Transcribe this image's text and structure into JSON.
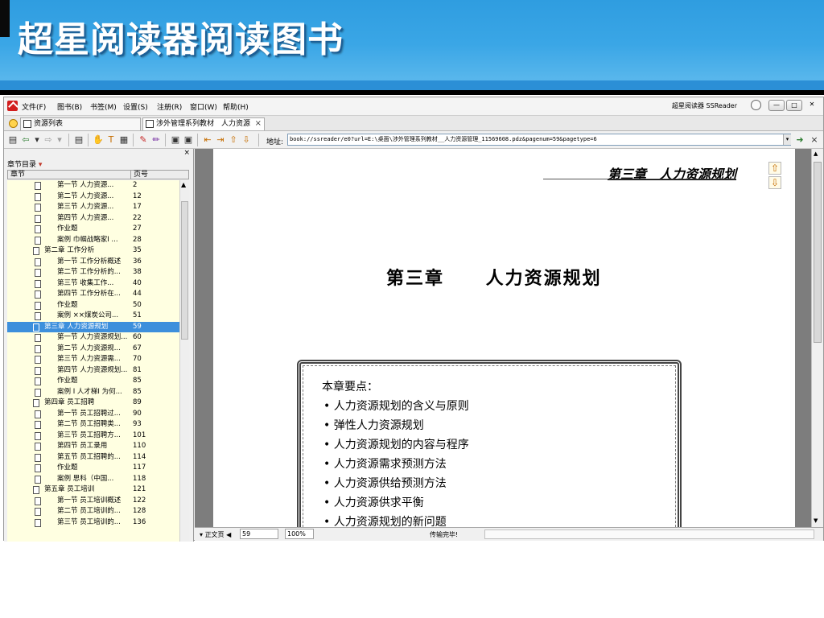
{
  "slide": {
    "title": "超星阅读器阅读图书"
  },
  "menubar": {
    "items": [
      "文件(F)",
      "图书(B)",
      "书签(M)",
      "设置(S)",
      "注册(R)",
      "窗口(W)",
      "帮助(H)"
    ],
    "brand": "超星阅读器 SSReader"
  },
  "tabs": [
    {
      "label": "资源列表"
    },
    {
      "label": "涉外管理系列教材　人力资源"
    }
  ],
  "address": {
    "label": "地址:",
    "value": "book://ssreader/e0?url=E:\\桌面\\涉外管理系列教材__人力资源管理_11569608.pdz&pagenum=59&pagetype=6"
  },
  "sidebar": {
    "close": "×",
    "title": "章节目录",
    "col_chapter": "章节",
    "col_page": "页号",
    "selected_index": 13,
    "items": [
      {
        "title": "第一节 人力资源...",
        "page": "2",
        "level": 2
      },
      {
        "title": "第二节 人力资源...",
        "page": "12",
        "level": 2
      },
      {
        "title": "第三节 人力资源...",
        "page": "17",
        "level": 2
      },
      {
        "title": "第四节 人力资源...",
        "page": "22",
        "level": 2
      },
      {
        "title": "作业题",
        "page": "27",
        "level": 2
      },
      {
        "title": "案例 巾帼战略家I ...",
        "page": "28",
        "level": 2
      },
      {
        "title": "第二章 工作分析",
        "page": "35",
        "level": 1
      },
      {
        "title": "第一节 工作分析概述",
        "page": "36",
        "level": 2
      },
      {
        "title": "第二节 工作分析的...",
        "page": "38",
        "level": 2
      },
      {
        "title": "第三节 收集工作...",
        "page": "40",
        "level": 2
      },
      {
        "title": "第四节 工作分析在...",
        "page": "44",
        "level": 2
      },
      {
        "title": "作业题",
        "page": "50",
        "level": 2
      },
      {
        "title": "案例 ××煤炭公司...",
        "page": "51",
        "level": 2
      },
      {
        "title": "第三章 人力资源规划",
        "page": "59",
        "level": 1
      },
      {
        "title": "第一节 人力资源规划...",
        "page": "60",
        "level": 2
      },
      {
        "title": "第二节 人力资源规...",
        "page": "67",
        "level": 2
      },
      {
        "title": "第三节 人力资源需...",
        "page": "70",
        "level": 2
      },
      {
        "title": "第四节 人力资源规划...",
        "page": "81",
        "level": 2
      },
      {
        "title": "作业题",
        "page": "85",
        "level": 2
      },
      {
        "title": "案例 I 人才梯I 为何...",
        "page": "85",
        "level": 2
      },
      {
        "title": "第四章 员工招聘",
        "page": "89",
        "level": 1
      },
      {
        "title": "第一节 员工招聘过...",
        "page": "90",
        "level": 2
      },
      {
        "title": "第二节 员工招聘类...",
        "page": "93",
        "level": 2
      },
      {
        "title": "第三节 员工招聘方...",
        "page": "101",
        "level": 2
      },
      {
        "title": "第四节 员工录用",
        "page": "110",
        "level": 2
      },
      {
        "title": "第五节 员工招聘的...",
        "page": "114",
        "level": 2
      },
      {
        "title": "作业题",
        "page": "117",
        "level": 2
      },
      {
        "title": "案例 思科（中国...",
        "page": "118",
        "level": 2
      },
      {
        "title": "第五章 员工培训",
        "page": "121",
        "level": 1
      },
      {
        "title": "第一节 员工培训概述",
        "page": "122",
        "level": 2
      },
      {
        "title": "第二节 员工培训的...",
        "page": "128",
        "level": 2
      },
      {
        "title": "第三节 员工培训的...",
        "page": "136",
        "level": 2
      }
    ]
  },
  "page": {
    "header_title": "第三章　人力资源规划",
    "chapter_heading": "第三章　 人力资源规划",
    "key_heading": "本章要点：",
    "key_points": [
      "• 人力资源规划的含义与原则",
      "• 弹性人力资源规划",
      "• 人力资源规划的内容与程序",
      "• 人力资源需求预测方法",
      "• 人力资源供给预测方法",
      "• 人力资源供求平衡",
      "• 人力资源规划的新问题"
    ]
  },
  "status": {
    "view_mode": "正文页",
    "page_number": "59",
    "zoom": "100%",
    "message": "传输完毕!"
  },
  "icons": {
    "app_logo": "ssreader-logo-icon",
    "page_up": "page-up-arrow-icon",
    "page_down": "page-down-arrow-icon"
  },
  "colors": {
    "header_blue": "#3aa6e6",
    "toc_background": "#ffffe1",
    "toc_selected": "#3d8fdc"
  }
}
